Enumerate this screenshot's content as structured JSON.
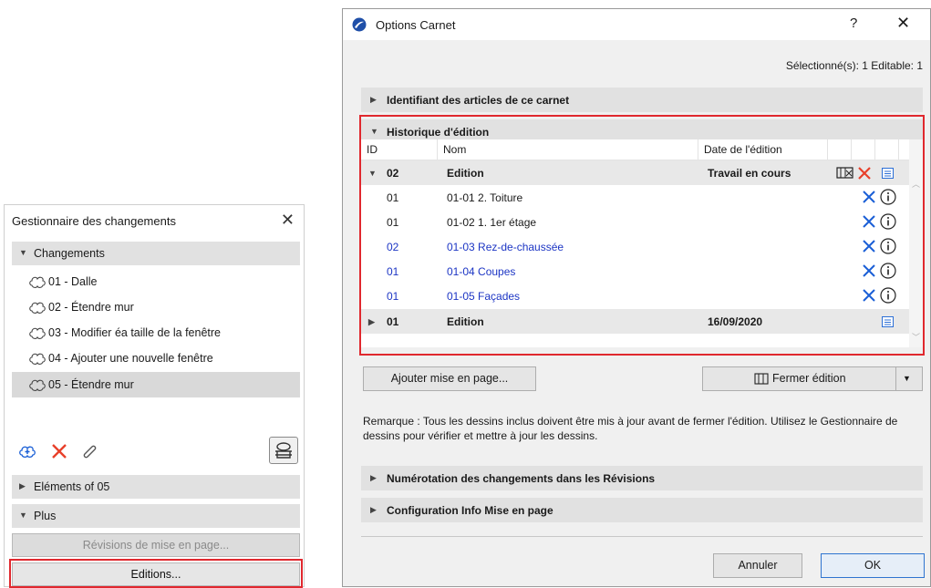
{
  "left_panel": {
    "title": "Gestionnaire des changements",
    "close_glyph": "✕",
    "changes_section": "Changements",
    "changes": [
      {
        "label": "01 - Dalle"
      },
      {
        "label": "02 - Étendre mur"
      },
      {
        "label": "03 - Modifier éa taille de la fenêtre"
      },
      {
        "label": "04 - Ajouter une nouvelle fenêtre"
      },
      {
        "label": "05 - Étendre mur",
        "selected": true
      }
    ],
    "tools": [
      "add-change-icon",
      "delete-icon",
      "attach-icon",
      "settings-stack-icon"
    ],
    "elements_section": "Eléments of 05",
    "more_section": "Plus",
    "revisions_button": "Révisions de mise en page...",
    "editions_button": "Editions..."
  },
  "dialog": {
    "title": "Options Carnet",
    "help_glyph": "?",
    "close_glyph": "✕",
    "selection_info": "Sélectionné(s): 1 Editable: 1",
    "section_identifiers": "Identifiant des articles de ce carnet",
    "section_history": "Historique d'édition",
    "table": {
      "headers": {
        "id": "ID",
        "name": "Nom",
        "date": "Date de l'édition"
      },
      "rows": [
        {
          "type": "group",
          "expanded": true,
          "id": "02",
          "name": "Edition",
          "date": "Travail en cours",
          "icons": [
            "close-issue-icon",
            "delete-icon",
            "details-icon"
          ]
        },
        {
          "type": "item",
          "id": "01",
          "name": "01-01 2. Toiture",
          "color": "normal"
        },
        {
          "type": "item",
          "id": "01",
          "name": "01-02 1. 1er étage",
          "color": "normal"
        },
        {
          "type": "item",
          "id": "02",
          "name": "01-03 Rez-de-chaussée",
          "color": "blue"
        },
        {
          "type": "item",
          "id": "01",
          "name": "01-04 Coupes",
          "color": "blue"
        },
        {
          "type": "item",
          "id": "01",
          "name": "01-05 Façades",
          "color": "blue"
        },
        {
          "type": "group",
          "expanded": false,
          "id": "01",
          "name": "Edition",
          "date": "16/09/2020",
          "icons": [
            "details-icon"
          ]
        }
      ]
    },
    "add_layout_button": "Ajouter mise en page...",
    "close_issue_button": "Fermer édition",
    "note": "Remarque : Tous les dessins inclus doivent être mis à jour avant de fermer l'édition. Utilisez le Gestionnaire de dessins pour vérifier et mettre à jour les dessins.",
    "section_numbering": "Numérotation des changements dans les Révisions",
    "section_config": "Configuration Info Mise en page",
    "cancel_button": "Annuler",
    "ok_button": "OK"
  },
  "colors": {
    "highlight_frame": "#e0282e",
    "delete_red": "#e8402a",
    "blue_x": "#1a5fd6",
    "blue_text": "#1c35c4"
  }
}
